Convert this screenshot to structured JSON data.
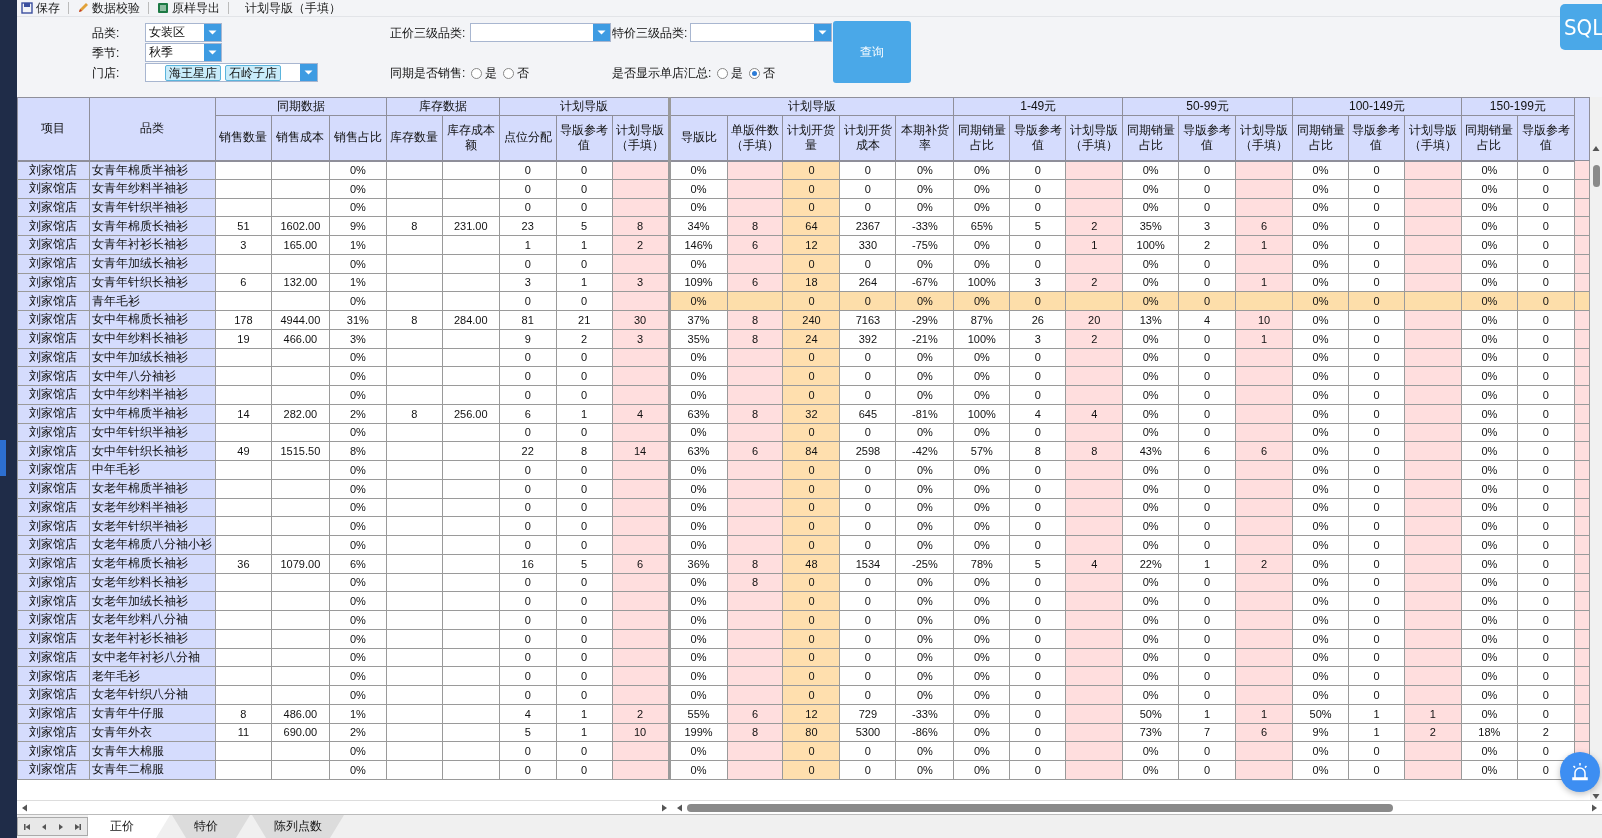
{
  "toolbar": {
    "buttons": [
      "保存",
      "数据校验",
      "原样导出"
    ],
    "title": "计划导版（手填）"
  },
  "filters": {
    "category": {
      "label": "品类:",
      "value": "女装区"
    },
    "season": {
      "label": "季节:",
      "value": "秋季"
    },
    "store": {
      "label": "门店:",
      "tags": [
        "海王星店",
        "石岭子店"
      ]
    },
    "regular_level3": {
      "label": "正价三级品类:"
    },
    "special_level3": {
      "label": "特价三级品类:"
    },
    "same_period_sales": {
      "label": "同期是否销售:",
      "options": [
        {
          "label": "是",
          "selected": false
        },
        {
          "label": "否",
          "selected": false
        }
      ]
    },
    "show_store_summary": {
      "label": "是否显示单店汇总:",
      "options": [
        {
          "label": "是",
          "selected": false
        },
        {
          "label": "否",
          "selected": true
        }
      ]
    }
  },
  "query_button": "查询",
  "sql_button": "SQL",
  "table": {
    "columns": [
      {
        "label": "项目"
      },
      {
        "label": "品类"
      }
    ],
    "groups": [
      {
        "label": "同期数据",
        "columns": [
          {
            "label": "销售数量",
            "kind": "plain"
          },
          {
            "label": "销售成本",
            "kind": "plain"
          },
          {
            "label": "销售占比",
            "kind": "plain"
          }
        ]
      },
      {
        "label": "库存数据",
        "columns": [
          {
            "label": "库存数量",
            "kind": "plain"
          },
          {
            "label": "库存成本额",
            "kind": "plain"
          }
        ]
      },
      {
        "label": "计划导版",
        "columns": [
          {
            "label": "点位分配",
            "kind": "plain"
          },
          {
            "label": "导版参考值",
            "kind": "plain"
          },
          {
            "label": "计划导版（手填）",
            "kind": "manual"
          }
        ]
      },
      {
        "label": "计划导版",
        "columns": [
          {
            "label": "导版比",
            "kind": "plain"
          },
          {
            "label": "单版件数（手填）",
            "kind": "manual"
          },
          {
            "label": "计划开货量",
            "kind": "plan"
          },
          {
            "label": "计划开货成本",
            "kind": "plain"
          },
          {
            "label": "本期补货率",
            "kind": "plain"
          }
        ]
      },
      {
        "label": "1-49元",
        "columns": [
          {
            "label": "同期销量占比",
            "kind": "plain"
          },
          {
            "label": "导版参考值",
            "kind": "plain"
          },
          {
            "label": "计划导版（手填）",
            "kind": "manual"
          }
        ]
      },
      {
        "label": "50-99元",
        "columns": [
          {
            "label": "同期销量占比",
            "kind": "plain"
          },
          {
            "label": "导版参考值",
            "kind": "plain"
          },
          {
            "label": "计划导版（手填）",
            "kind": "manual"
          }
        ]
      },
      {
        "label": "100-149元",
        "columns": [
          {
            "label": "同期销量占比",
            "kind": "plain"
          },
          {
            "label": "导版参考值",
            "kind": "plain"
          },
          {
            "label": "计划导版（手填）",
            "kind": "manual"
          }
        ]
      },
      {
        "label": "150-199元",
        "columns": [
          {
            "label": "同期销量占比",
            "kind": "plain"
          },
          {
            "label": "导版参考值",
            "kind": "plain"
          }
        ]
      }
    ],
    "rows": [
      {
        "store": "刘家馆店",
        "category": "女青年棉质半袖衫",
        "selected": false,
        "cells": [
          null,
          null,
          "0%",
          null,
          null,
          "0",
          "0",
          null,
          "0%",
          null,
          "0",
          "0",
          "0%",
          "0%",
          "0",
          null,
          "0%",
          "0",
          null,
          "0%",
          "0",
          null,
          "0%",
          "0"
        ]
      },
      {
        "store": "刘家馆店",
        "category": "女青年纱料半袖衫",
        "selected": false,
        "cells": [
          null,
          null,
          "0%",
          null,
          null,
          "0",
          "0",
          null,
          "0%",
          null,
          "0",
          "0",
          "0%",
          "0%",
          "0",
          null,
          "0%",
          "0",
          null,
          "0%",
          "0",
          null,
          "0%",
          "0"
        ]
      },
      {
        "store": "刘家馆店",
        "category": "女青年针织半袖衫",
        "selected": false,
        "cells": [
          null,
          null,
          "0%",
          null,
          null,
          "0",
          "0",
          null,
          "0%",
          null,
          "0",
          "0",
          "0%",
          "0%",
          "0",
          null,
          "0%",
          "0",
          null,
          "0%",
          "0",
          null,
          "0%",
          "0"
        ]
      },
      {
        "store": "刘家馆店",
        "category": "女青年棉质长袖衫",
        "selected": false,
        "cells": [
          "51",
          "1602.00",
          "9%",
          "8",
          "231.00",
          "23",
          "5",
          "8",
          "34%",
          "8",
          "64",
          "2367",
          "-33%",
          "65%",
          "5",
          "2",
          "35%",
          "3",
          "6",
          "0%",
          "0",
          null,
          "0%",
          "0"
        ]
      },
      {
        "store": "刘家馆店",
        "category": "女青年衬衫长袖衫",
        "selected": false,
        "cells": [
          "3",
          "165.00",
          "1%",
          null,
          null,
          "1",
          "1",
          "2",
          "146%",
          "6",
          "12",
          "330",
          "-75%",
          "0%",
          "0",
          "1",
          "100%",
          "2",
          "1",
          "0%",
          "0",
          null,
          "0%",
          "0"
        ]
      },
      {
        "store": "刘家馆店",
        "category": "女青年加绒长袖衫",
        "selected": false,
        "cells": [
          null,
          null,
          "0%",
          null,
          null,
          "0",
          "0",
          null,
          "0%",
          null,
          "0",
          "0",
          "0%",
          "0%",
          "0",
          null,
          "0%",
          "0",
          null,
          "0%",
          "0",
          null,
          "0%",
          "0"
        ]
      },
      {
        "store": "刘家馆店",
        "category": "女青年针织长袖衫",
        "selected": false,
        "cells": [
          "6",
          "132.00",
          "1%",
          null,
          null,
          "3",
          "1",
          "3",
          "109%",
          "6",
          "18",
          "264",
          "-67%",
          "100%",
          "3",
          "2",
          "0%",
          "0",
          "1",
          "0%",
          "0",
          null,
          "0%",
          "0"
        ]
      },
      {
        "store": "刘家馆店",
        "category": "青年毛衫",
        "selected": true,
        "cells": [
          null,
          null,
          "0%",
          null,
          null,
          "0",
          "0",
          null,
          "0%",
          null,
          "0",
          "0",
          "0%",
          "0%",
          "0",
          null,
          "0%",
          "0",
          null,
          "0%",
          "0",
          null,
          "0%",
          "0"
        ]
      },
      {
        "store": "刘家馆店",
        "category": "女中年棉质长袖衫",
        "selected": false,
        "cells": [
          "178",
          "4944.00",
          "31%",
          "8",
          "284.00",
          "81",
          "21",
          "30",
          "37%",
          "8",
          "240",
          "7163",
          "-29%",
          "87%",
          "26",
          "20",
          "13%",
          "4",
          "10",
          "0%",
          "0",
          null,
          "0%",
          "0"
        ]
      },
      {
        "store": "刘家馆店",
        "category": "女中年纱料长袖衫",
        "selected": false,
        "cells": [
          "19",
          "466.00",
          "3%",
          null,
          null,
          "9",
          "2",
          "3",
          "35%",
          "8",
          "24",
          "392",
          "-21%",
          "100%",
          "3",
          "2",
          "0%",
          "0",
          "1",
          "0%",
          "0",
          null,
          "0%",
          "0"
        ]
      },
      {
        "store": "刘家馆店",
        "category": "女中年加绒长袖衫",
        "selected": false,
        "cells": [
          null,
          null,
          "0%",
          null,
          null,
          "0",
          "0",
          null,
          "0%",
          null,
          "0",
          "0",
          "0%",
          "0%",
          "0",
          null,
          "0%",
          "0",
          null,
          "0%",
          "0",
          null,
          "0%",
          "0"
        ]
      },
      {
        "store": "刘家馆店",
        "category": "女中年八分袖衫",
        "selected": false,
        "cells": [
          null,
          null,
          "0%",
          null,
          null,
          "0",
          "0",
          null,
          "0%",
          null,
          "0",
          "0",
          "0%",
          "0%",
          "0",
          null,
          "0%",
          "0",
          null,
          "0%",
          "0",
          null,
          "0%",
          "0"
        ]
      },
      {
        "store": "刘家馆店",
        "category": "女中年纱料半袖衫",
        "selected": false,
        "cells": [
          null,
          null,
          "0%",
          null,
          null,
          "0",
          "0",
          null,
          "0%",
          null,
          "0",
          "0",
          "0%",
          "0%",
          "0",
          null,
          "0%",
          "0",
          null,
          "0%",
          "0",
          null,
          "0%",
          "0"
        ]
      },
      {
        "store": "刘家馆店",
        "category": "女中年棉质半袖衫",
        "selected": false,
        "cells": [
          "14",
          "282.00",
          "2%",
          "8",
          "256.00",
          "6",
          "1",
          "4",
          "63%",
          "8",
          "32",
          "645",
          "-81%",
          "100%",
          "4",
          "4",
          "0%",
          "0",
          null,
          "0%",
          "0",
          null,
          "0%",
          "0"
        ]
      },
      {
        "store": "刘家馆店",
        "category": "女中年针织半袖衫",
        "selected": false,
        "cells": [
          null,
          null,
          "0%",
          null,
          null,
          "0",
          "0",
          null,
          "0%",
          null,
          "0",
          "0",
          "0%",
          "0%",
          "0",
          null,
          "0%",
          "0",
          null,
          "0%",
          "0",
          null,
          "0%",
          "0"
        ]
      },
      {
        "store": "刘家馆店",
        "category": "女中年针织长袖衫",
        "selected": false,
        "cells": [
          "49",
          "1515.50",
          "8%",
          null,
          null,
          "22",
          "8",
          "14",
          "63%",
          "6",
          "84",
          "2598",
          "-42%",
          "57%",
          "8",
          "8",
          "43%",
          "6",
          "6",
          "0%",
          "0",
          null,
          "0%",
          "0"
        ]
      },
      {
        "store": "刘家馆店",
        "category": "中年毛衫",
        "selected": false,
        "cells": [
          null,
          null,
          "0%",
          null,
          null,
          "0",
          "0",
          null,
          "0%",
          null,
          "0",
          "0",
          "0%",
          "0%",
          "0",
          null,
          "0%",
          "0",
          null,
          "0%",
          "0",
          null,
          "0%",
          "0"
        ]
      },
      {
        "store": "刘家馆店",
        "category": "女老年棉质半袖衫",
        "selected": false,
        "cells": [
          null,
          null,
          "0%",
          null,
          null,
          "0",
          "0",
          null,
          "0%",
          null,
          "0",
          "0",
          "0%",
          "0%",
          "0",
          null,
          "0%",
          "0",
          null,
          "0%",
          "0",
          null,
          "0%",
          "0"
        ]
      },
      {
        "store": "刘家馆店",
        "category": "女老年纱料半袖衫",
        "selected": false,
        "cells": [
          null,
          null,
          "0%",
          null,
          null,
          "0",
          "0",
          null,
          "0%",
          null,
          "0",
          "0",
          "0%",
          "0%",
          "0",
          null,
          "0%",
          "0",
          null,
          "0%",
          "0",
          null,
          "0%",
          "0"
        ]
      },
      {
        "store": "刘家馆店",
        "category": "女老年针织半袖衫",
        "selected": false,
        "cells": [
          null,
          null,
          "0%",
          null,
          null,
          "0",
          "0",
          null,
          "0%",
          null,
          "0",
          "0",
          "0%",
          "0%",
          "0",
          null,
          "0%",
          "0",
          null,
          "0%",
          "0",
          null,
          "0%",
          "0"
        ]
      },
      {
        "store": "刘家馆店",
        "category": "女老年棉质八分袖小衫",
        "selected": false,
        "cells": [
          null,
          null,
          "0%",
          null,
          null,
          "0",
          "0",
          null,
          "0%",
          null,
          "0",
          "0",
          "0%",
          "0%",
          "0",
          null,
          "0%",
          "0",
          null,
          "0%",
          "0",
          null,
          "0%",
          "0"
        ]
      },
      {
        "store": "刘家馆店",
        "category": "女老年棉质长袖衫",
        "selected": false,
        "cells": [
          "36",
          "1079.00",
          "6%",
          null,
          null,
          "16",
          "5",
          "6",
          "36%",
          "8",
          "48",
          "1534",
          "-25%",
          "78%",
          "5",
          "4",
          "22%",
          "1",
          "2",
          "0%",
          "0",
          null,
          "0%",
          "0"
        ]
      },
      {
        "store": "刘家馆店",
        "category": "女老年纱料长袖衫",
        "selected": false,
        "cells": [
          null,
          null,
          "0%",
          null,
          null,
          "0",
          "0",
          null,
          "0%",
          "8",
          "0",
          "0",
          "0%",
          "0%",
          "0",
          null,
          "0%",
          "0",
          null,
          "0%",
          "0",
          null,
          "0%",
          "0"
        ]
      },
      {
        "store": "刘家馆店",
        "category": "女老年加绒长袖衫",
        "selected": false,
        "cells": [
          null,
          null,
          "0%",
          null,
          null,
          "0",
          "0",
          null,
          "0%",
          null,
          "0",
          "0",
          "0%",
          "0%",
          "0",
          null,
          "0%",
          "0",
          null,
          "0%",
          "0",
          null,
          "0%",
          "0"
        ]
      },
      {
        "store": "刘家馆店",
        "category": "女老年纱料八分袖",
        "selected": false,
        "cells": [
          null,
          null,
          "0%",
          null,
          null,
          "0",
          "0",
          null,
          "0%",
          null,
          "0",
          "0",
          "0%",
          "0%",
          "0",
          null,
          "0%",
          "0",
          null,
          "0%",
          "0",
          null,
          "0%",
          "0"
        ]
      },
      {
        "store": "刘家馆店",
        "category": "女老年衬衫长袖衫",
        "selected": false,
        "cells": [
          null,
          null,
          "0%",
          null,
          null,
          "0",
          "0",
          null,
          "0%",
          null,
          "0",
          "0",
          "0%",
          "0%",
          "0",
          null,
          "0%",
          "0",
          null,
          "0%",
          "0",
          null,
          "0%",
          "0"
        ]
      },
      {
        "store": "刘家馆店",
        "category": "女中老年衬衫八分袖",
        "selected": false,
        "cells": [
          null,
          null,
          "0%",
          null,
          null,
          "0",
          "0",
          null,
          "0%",
          null,
          "0",
          "0",
          "0%",
          "0%",
          "0",
          null,
          "0%",
          "0",
          null,
          "0%",
          "0",
          null,
          "0%",
          "0"
        ]
      },
      {
        "store": "刘家馆店",
        "category": "老年毛衫",
        "selected": false,
        "cells": [
          null,
          null,
          "0%",
          null,
          null,
          "0",
          "0",
          null,
          "0%",
          null,
          "0",
          "0",
          "0%",
          "0%",
          "0",
          null,
          "0%",
          "0",
          null,
          "0%",
          "0",
          null,
          "0%",
          "0"
        ]
      },
      {
        "store": "刘家馆店",
        "category": "女老年针织八分袖",
        "selected": false,
        "cells": [
          null,
          null,
          "0%",
          null,
          null,
          "0",
          "0",
          null,
          "0%",
          null,
          "0",
          "0",
          "0%",
          "0%",
          "0",
          null,
          "0%",
          "0",
          null,
          "0%",
          "0",
          null,
          "0%",
          "0"
        ]
      },
      {
        "store": "刘家馆店",
        "category": "女青年牛仔服",
        "selected": false,
        "cells": [
          "8",
          "486.00",
          "1%",
          null,
          null,
          "4",
          "1",
          "2",
          "55%",
          "6",
          "12",
          "729",
          "-33%",
          "0%",
          "0",
          null,
          "50%",
          "1",
          "1",
          "50%",
          "1",
          "1",
          "0%",
          "0"
        ]
      },
      {
        "store": "刘家馆店",
        "category": "女青年外衣",
        "selected": false,
        "cells": [
          "11",
          "690.00",
          "2%",
          null,
          null,
          "5",
          "1",
          "10",
          "199%",
          "8",
          "80",
          "5300",
          "-86%",
          "0%",
          "0",
          null,
          "73%",
          "7",
          "6",
          "9%",
          "1",
          "2",
          "18%",
          "2"
        ]
      },
      {
        "store": "刘家馆店",
        "category": "女青年大棉服",
        "selected": false,
        "cells": [
          null,
          null,
          "0%",
          null,
          null,
          "0",
          "0",
          null,
          "0%",
          null,
          "0",
          "0",
          "0%",
          "0%",
          "0",
          null,
          "0%",
          "0",
          null,
          "0%",
          "0",
          null,
          "0%",
          "0"
        ]
      },
      {
        "store": "刘家馆店",
        "category": "女青年二棉服",
        "selected": false,
        "cells": [
          null,
          null,
          "0%",
          null,
          null,
          "0",
          "0",
          null,
          "0%",
          null,
          "0",
          "0",
          "0%",
          "0%",
          "0",
          null,
          "0%",
          "0",
          null,
          "0%",
          "0",
          null,
          "0%",
          "0"
        ]
      }
    ]
  },
  "sheet_tabs": [
    {
      "label": "正价",
      "selected": true
    },
    {
      "label": "特价",
      "selected": false
    },
    {
      "label": "陈列点数",
      "selected": false
    }
  ]
}
